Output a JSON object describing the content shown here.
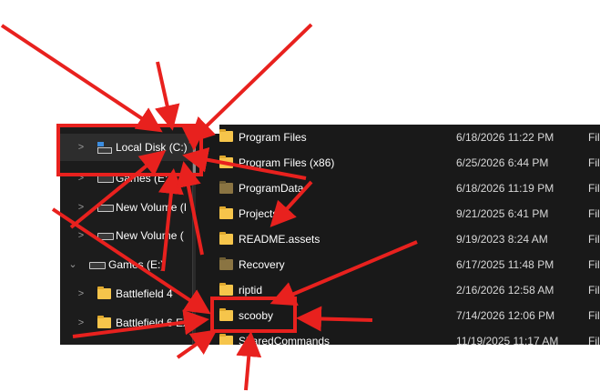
{
  "nav": {
    "items": [
      {
        "label": "Local Disk (C:)",
        "chevron": ">",
        "icon": "os-drive-icon"
      },
      {
        "label": "Games (E:)",
        "chevron": ">",
        "icon": "drive-icon"
      },
      {
        "label": "New Volume (I",
        "chevron": ">",
        "icon": "drive-icon"
      },
      {
        "label": "New Volume (",
        "chevron": ">",
        "icon": "drive-icon"
      },
      {
        "label": "Games (E:)",
        "chevron": "⌄",
        "icon": "drive-icon"
      },
      {
        "label": "Battlefield 4",
        "chevron": ">",
        "icon": "folder-icon"
      },
      {
        "label": "Battlefield 6 Ex",
        "chevron": ">",
        "icon": "folder-icon"
      }
    ]
  },
  "files": {
    "rows": [
      {
        "name": "Program Files",
        "date": "6/18/2026 11:22 PM",
        "type": "File",
        "icon": "folder-icon"
      },
      {
        "name": "Program Files (x86)",
        "date": "6/25/2026 6:44 PM",
        "type": "File",
        "icon": "folder-icon"
      },
      {
        "name": "ProgramData",
        "date": "6/18/2026 11:19 PM",
        "type": "File",
        "icon": "hidden-folder-icon"
      },
      {
        "name": "Projects",
        "date": "9/21/2025 6:41 PM",
        "type": "File",
        "icon": "folder-icon"
      },
      {
        "name": "README.assets",
        "date": "9/19/2023 8:24 AM",
        "type": "File",
        "icon": "folder-icon"
      },
      {
        "name": "Recovery",
        "date": "6/17/2025 11:48 PM",
        "type": "File",
        "icon": "hidden-folder-icon"
      },
      {
        "name": "riptid",
        "date": "2/16/2026 12:58 AM",
        "type": "File",
        "icon": "folder-icon"
      },
      {
        "name": "scooby",
        "date": "7/14/2026 12:06 PM",
        "type": "File",
        "icon": "folder-icon"
      },
      {
        "name": "SharedCommands",
        "date": "11/19/2025 11:17 AM",
        "type": "File",
        "icon": "folder-icon"
      }
    ]
  },
  "annotation": {
    "color": "#e8211e"
  }
}
